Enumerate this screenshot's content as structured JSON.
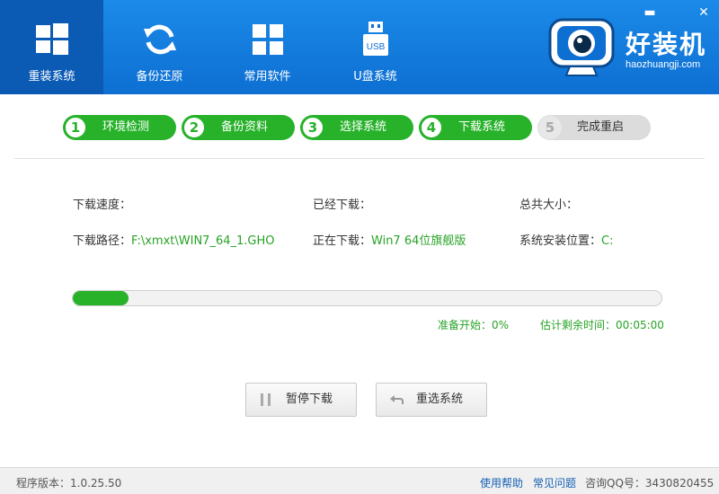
{
  "nav": {
    "items": [
      {
        "label": "重装系统",
        "icon": "windows-icon",
        "active": true
      },
      {
        "label": "备份还原",
        "icon": "refresh-icon"
      },
      {
        "label": "常用软件",
        "icon": "apps-grid-icon"
      },
      {
        "label": "U盘系统",
        "icon": "usb-drive-icon",
        "icon_text": "USB"
      }
    ]
  },
  "window": {
    "minimize": "▬",
    "close": "✕"
  },
  "brand": {
    "name": "好装机",
    "url": "haozhuangji.com"
  },
  "steps": [
    {
      "num": "1",
      "label": "环境检测",
      "state": "done"
    },
    {
      "num": "2",
      "label": "备份资料",
      "state": "done"
    },
    {
      "num": "3",
      "label": "选择系统",
      "state": "done"
    },
    {
      "num": "4",
      "label": "下载系统",
      "state": "done"
    },
    {
      "num": "5",
      "label": "完成重启",
      "state": "todo"
    }
  ],
  "info": {
    "speed_label": "下载速度：",
    "downloaded_label": "已经下载：",
    "total_label": "总共大小：",
    "path_label": "下载路径：",
    "path_value": "F:\\xmxt\\WIN7_64_1.GHO",
    "current_label": "正在下载：",
    "current_value": "Win7 64位旗舰版",
    "install_label": "系统安装位置：",
    "install_value": "C:"
  },
  "progress": {
    "fraction": 0.095,
    "status": "准备开始：0%",
    "remaining": "估计剩余时间：00:05:00"
  },
  "buttons": {
    "pause": {
      "label": "暂停下载",
      "icon": "pause-icon"
    },
    "reselect": {
      "label": "重选系统",
      "icon": "back-arrow-icon"
    }
  },
  "footer": {
    "version": "程序版本：1.0.25.50",
    "help": "使用帮助",
    "faq": "常见问题",
    "qq": "咨询QQ号：3430820455"
  },
  "colors": {
    "header_blue": "#0d6fd2",
    "active_blue": "#0b5bb5",
    "green": "#27b22a",
    "link": "#1560b4"
  }
}
